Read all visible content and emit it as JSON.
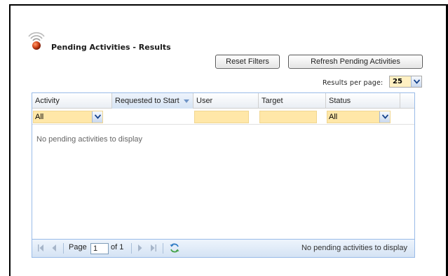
{
  "page": {
    "title": "Pending Activities - Results"
  },
  "toolbar": {
    "reset_label": "Reset Filters",
    "refresh_label": "Refresh Pending Activities"
  },
  "results_per_page": {
    "label": "Results per page:",
    "value": "25"
  },
  "grid": {
    "columns": [
      {
        "label": "Activity"
      },
      {
        "label": "Requested to Start",
        "sorted": "descending"
      },
      {
        "label": "User"
      },
      {
        "label": "Target"
      },
      {
        "label": "Status"
      }
    ],
    "filters": {
      "activity": "All",
      "status": "All"
    },
    "empty_message": "No pending activities to display"
  },
  "pager": {
    "page_label": "Page",
    "current_page": "1",
    "of_label": "of 1",
    "status_text": "No pending activities to display"
  },
  "colors": {
    "filter_bg": "#ffe7a8",
    "grid_border": "#99bbe8",
    "logo_accent": "#d64a1e"
  }
}
